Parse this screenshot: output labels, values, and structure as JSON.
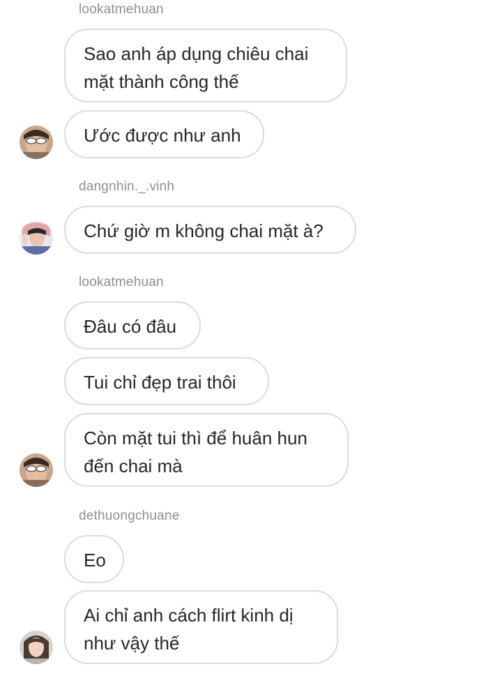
{
  "groups": [
    {
      "sender": "lookatmehuan",
      "messages": [
        "Sao anh áp dụng chiêu chai\nmặt thành công thế",
        "Ước được như anh"
      ],
      "avatar": "avatar-user-sunglasses"
    },
    {
      "sender": "dangnhin._.vinh",
      "messages": [
        "Chứ giờ m không chai mặt à?"
      ],
      "avatar": "avatar-user-waving"
    },
    {
      "sender": "lookatmehuan",
      "messages": [
        "Đâu có đâu",
        "Tui chỉ đẹp trai thôi",
        "Còn mặt tui thì để huân hun\nđến chai mà"
      ],
      "avatar": "avatar-user-sunglasses"
    },
    {
      "sender": "dethuongchuane",
      "messages": [
        "Eo",
        "Ai chỉ anh cách flirt kinh dị\nnhư vậy thế"
      ],
      "avatar": "avatar-user-girl"
    }
  ]
}
